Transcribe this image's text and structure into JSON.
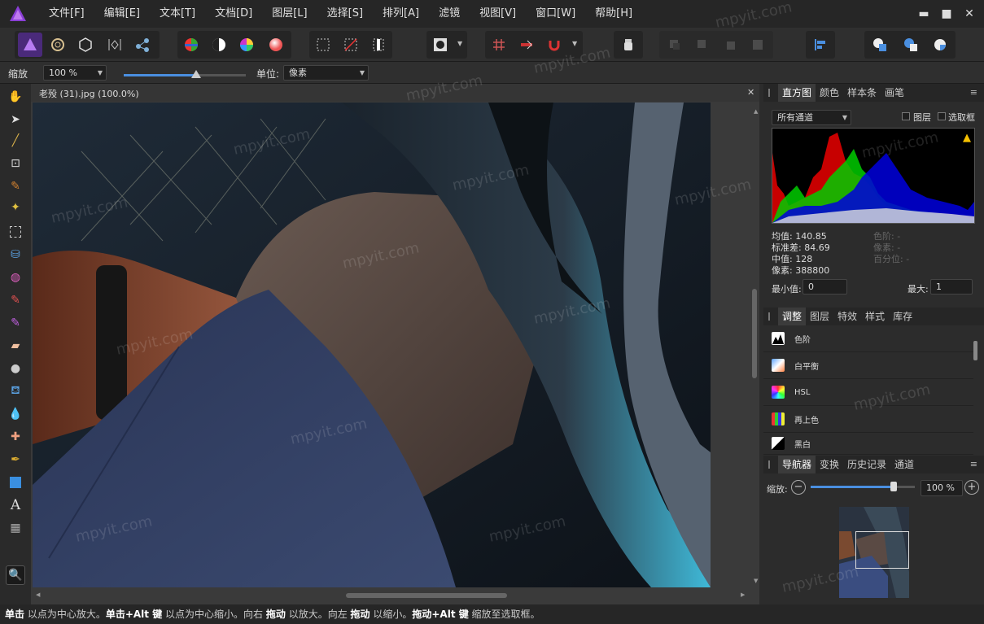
{
  "menu": {
    "items": [
      "文件[F]",
      "编辑[E]",
      "文本[T]",
      "文档[D]",
      "图层[L]",
      "选择[S]",
      "排列[A]",
      "滤镜",
      "视图[V]",
      "窗口[W]",
      "帮助[H]"
    ]
  },
  "window_controls": {
    "minimize": "▬",
    "maximize": "■",
    "close": "✕"
  },
  "context_bar": {
    "zoom_label": "缩放",
    "zoom_value": "100 %",
    "unit_label": "单位:",
    "unit_value": "像素"
  },
  "document": {
    "tab_title": "老殁 (31).jpg (100.0%)",
    "close_glyph": "✕"
  },
  "histogram_panel": {
    "tabs": [
      "直方图",
      "颜色",
      "样本条",
      "画笔"
    ],
    "channel_select": "所有通道",
    "layer_checkbox": "图层",
    "marquee_checkbox": "选取框",
    "stats": {
      "mean": "均值: 140.85",
      "std": "标准差: 84.69",
      "median": "中值: 128",
      "pixels": "像素: 388800"
    },
    "dim_stats": {
      "level": "色阶: -",
      "count": "像素: -",
      "percentile": "百分位: -"
    },
    "min_label": "最小值:",
    "min_value": "0",
    "max_label": "最大:",
    "max_value": "1"
  },
  "adjust_panel": {
    "tabs": [
      "调整",
      "图层",
      "特效",
      "样式",
      "库存"
    ],
    "items": [
      "色阶",
      "白平衡",
      "HSL",
      "再上色",
      "黑白"
    ]
  },
  "navigator_panel": {
    "tabs": [
      "导航器",
      "变换",
      "历史记录",
      "通道"
    ],
    "zoom_label": "缩放:",
    "zoom_value": "100 %",
    "zoom_fraction": 0.8
  },
  "status": {
    "parts": [
      {
        "b": "单击"
      },
      {
        "t": " 以点为中心放大。"
      },
      {
        "b": "单击+Alt 键"
      },
      {
        "t": " 以点为中心缩小。向右 "
      },
      {
        "b": "拖动"
      },
      {
        "t": " 以放大。向左 "
      },
      {
        "b": "拖动"
      },
      {
        "t": " 以缩小。"
      },
      {
        "b": "拖动+Alt 键"
      },
      {
        "t": " 缩放至选取框。"
      }
    ]
  },
  "watermark": "mpyit.com",
  "colors": {
    "accent": "#7b3fe4",
    "panel": "#2c2c2c",
    "menubar": "#262626"
  }
}
